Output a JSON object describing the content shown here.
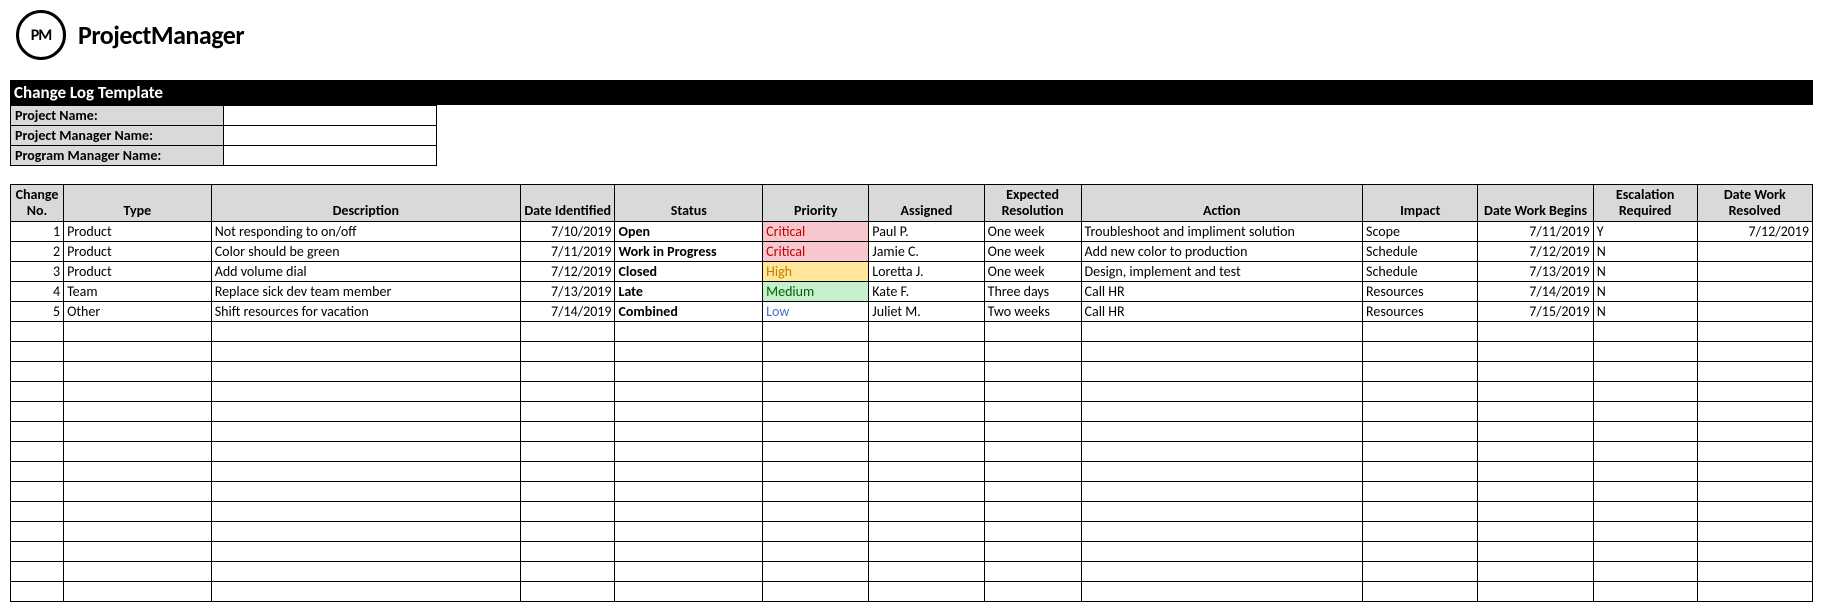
{
  "brand": "ProjectManager",
  "logo_text": "PM",
  "title": "Change Log Template",
  "meta": {
    "project_name_label": "Project Name:",
    "project_name_value": "",
    "project_manager_label": "Project Manager Name:",
    "project_manager_value": "",
    "program_manager_label": "Program Manager Name:",
    "program_manager_value": ""
  },
  "headers": {
    "change_no": "Change No.",
    "type": "Type",
    "description": "Description",
    "date_identified": "Date Identified",
    "status": "Status",
    "priority": "Priority",
    "assigned": "Assigned",
    "expected_resolution": "Expected Resolution",
    "action": "Action",
    "impact": "Impact",
    "date_work_begins": "Date Work Begins",
    "escalation_required": "Escalation Required",
    "date_work_resolved": "Date Work Resolved"
  },
  "rows": [
    {
      "no": "1",
      "type": "Product",
      "description": "Not responding to on/off",
      "date_identified": "7/10/2019",
      "status": "Open",
      "priority": "Critical",
      "assigned": "Paul P.",
      "expected": "One week",
      "action": "Troubleshoot and impliment solution",
      "impact": "Scope",
      "date_begin": "7/11/2019",
      "escalation": "Y",
      "date_resolved": "7/12/2019"
    },
    {
      "no": "2",
      "type": "Product",
      "description": "Color should be green",
      "date_identified": "7/11/2019",
      "status": "Work in Progress",
      "priority": "Critical",
      "assigned": "Jamie C.",
      "expected": "One week",
      "action": "Add new color to production",
      "impact": "Schedule",
      "date_begin": "7/12/2019",
      "escalation": "N",
      "date_resolved": ""
    },
    {
      "no": "3",
      "type": "Product",
      "description": "Add volume dial",
      "date_identified": "7/12/2019",
      "status": "Closed",
      "priority": "High",
      "assigned": "Loretta J.",
      "expected": "One week",
      "action": "Design, implement and test",
      "impact": "Schedule",
      "date_begin": "7/13/2019",
      "escalation": "N",
      "date_resolved": ""
    },
    {
      "no": "4",
      "type": "Team",
      "description": "Replace sick dev team member",
      "date_identified": "7/13/2019",
      "status": "Late",
      "priority": "Medium",
      "assigned": "Kate F.",
      "expected": "Three days",
      "action": "Call HR",
      "impact": "Resources",
      "date_begin": "7/14/2019",
      "escalation": "N",
      "date_resolved": ""
    },
    {
      "no": "5",
      "type": "Other",
      "description": "Shift resources for vacation",
      "date_identified": "7/14/2019",
      "status": "Combined",
      "priority": "Low",
      "assigned": "Juliet M.",
      "expected": "Two weeks",
      "action": "Call HR",
      "impact": "Resources",
      "date_begin": "7/15/2019",
      "escalation": "N",
      "date_resolved": ""
    }
  ],
  "empty_rows": 14
}
